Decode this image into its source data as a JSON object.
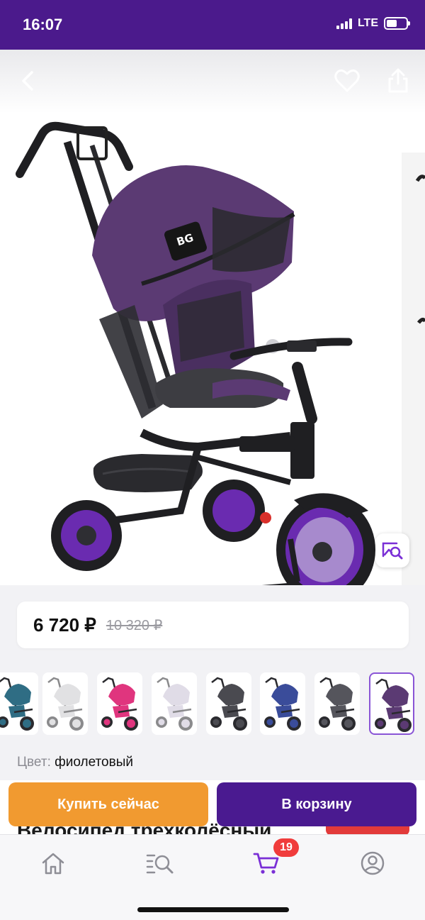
{
  "status_bar": {
    "time": "16:07",
    "network": "LTE",
    "battery_level": 0.55
  },
  "header": {
    "back_icon": "chevron-left-icon",
    "favorite_icon": "heart-icon",
    "share_icon": "share-icon",
    "image_search_icon": "image-search-icon"
  },
  "product": {
    "price_current": "6 720 ₽",
    "price_old": "10 320 ₽",
    "color_label": "Цвет:",
    "color_value": "фиолетовый",
    "title_peek": "Велосипед трехколёсный",
    "colors": {
      "main_purple": "#5b3a73",
      "wheel_purple": "#6a2bb0",
      "frame_black": "#1f1f22"
    }
  },
  "thumbnails": [
    {
      "name": "teal",
      "color": "#2f6d84",
      "faded": false,
      "selected": false
    },
    {
      "name": "grey-light",
      "color": "#c9c9cc",
      "faded": true,
      "selected": false
    },
    {
      "name": "pink",
      "color": "#e0357e",
      "faded": false,
      "selected": false
    },
    {
      "name": "lilac-light",
      "color": "#c7bfd4",
      "faded": true,
      "selected": false
    },
    {
      "name": "dark-grey",
      "color": "#4a4a50",
      "faded": false,
      "selected": false
    },
    {
      "name": "blue",
      "color": "#3a4c9a",
      "faded": false,
      "selected": false
    },
    {
      "name": "graphite",
      "color": "#55555c",
      "faded": false,
      "selected": false
    },
    {
      "name": "purple",
      "color": "#5b3a73",
      "faded": false,
      "selected": true
    }
  ],
  "actions": {
    "buy_now": "Купить сейчас",
    "add_to_cart": "В корзину"
  },
  "tabbar": {
    "items": [
      {
        "name": "home",
        "icon": "home-icon"
      },
      {
        "name": "catalog-search",
        "icon": "catalog-search-icon"
      },
      {
        "name": "cart",
        "icon": "cart-icon",
        "badge": "19"
      },
      {
        "name": "profile",
        "icon": "profile-icon"
      }
    ],
    "accent": "#7a2fd6"
  }
}
